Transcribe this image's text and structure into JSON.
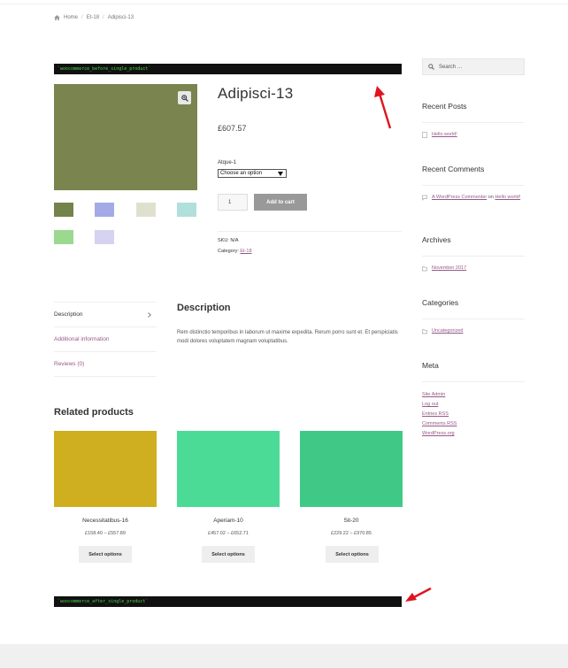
{
  "breadcrumb": {
    "home": "Home",
    "category": "Et-18",
    "current": "Adipisci-13"
  },
  "hooks": {
    "before": "`woocommerce_before_single_product`",
    "after": "`woocommerce_after_single_product`"
  },
  "product": {
    "title": "Adipisci-13",
    "price": "£607.57",
    "variation_label": "Atque-1",
    "variation_selected": "Choose an option",
    "quantity": "1",
    "add_to_cart": "Add to cart",
    "sku_label": "SKU: N/A",
    "category_label": "Category:",
    "category_value": "Et-18",
    "main_image_color": "#7a844f",
    "thumbnails": [
      "#74824b",
      "#a3aae6",
      "#dfe1ce",
      "#b1dfdb",
      "#9ad98f",
      "#d5d3f0"
    ]
  },
  "tabs": {
    "items": [
      {
        "label": "Description",
        "active": true
      },
      {
        "label": "Additional information",
        "active": false
      },
      {
        "label": "Reviews (0)",
        "active": false
      }
    ],
    "description_heading": "Description",
    "description_text": "Rem distinctio temporibus in laborum ut maxime expedita. Rerum porro sunt et. Et perspiciatis modi dolores voluptatem magnam voluptatibus."
  },
  "related": {
    "heading": "Related products",
    "products": [
      {
        "name": "Necessitatibus-16",
        "price": "£158.40 – £557.89",
        "button": "Select options",
        "color": "#cfae1f"
      },
      {
        "name": "Aperiam-10",
        "price": "£457.02 – £652.71",
        "button": "Select options",
        "color": "#4cdb97"
      },
      {
        "name": "Sit-20",
        "price": "£229.22 – £970.85",
        "button": "Select options",
        "color": "#40c986"
      }
    ]
  },
  "sidebar": {
    "search_placeholder": "Search …",
    "recent_posts": {
      "title": "Recent Posts",
      "items": [
        "Hello world!"
      ]
    },
    "recent_comments": {
      "title": "Recent Comments",
      "author": "A WordPress Commenter",
      "on": "on",
      "post": "Hello world!"
    },
    "archives": {
      "title": "Archives",
      "items": [
        "November 2017"
      ]
    },
    "categories": {
      "title": "Categories",
      "items": [
        "Uncategorized"
      ]
    },
    "meta": {
      "title": "Meta",
      "items": [
        "Site Admin",
        "Log out",
        "Entries RSS",
        "Comments RSS",
        "WordPress.org"
      ]
    }
  },
  "colors": {
    "link": "#96588a",
    "hook_bg": "#111111",
    "hook_text": "#48d448",
    "arrow": "#e0141e"
  }
}
